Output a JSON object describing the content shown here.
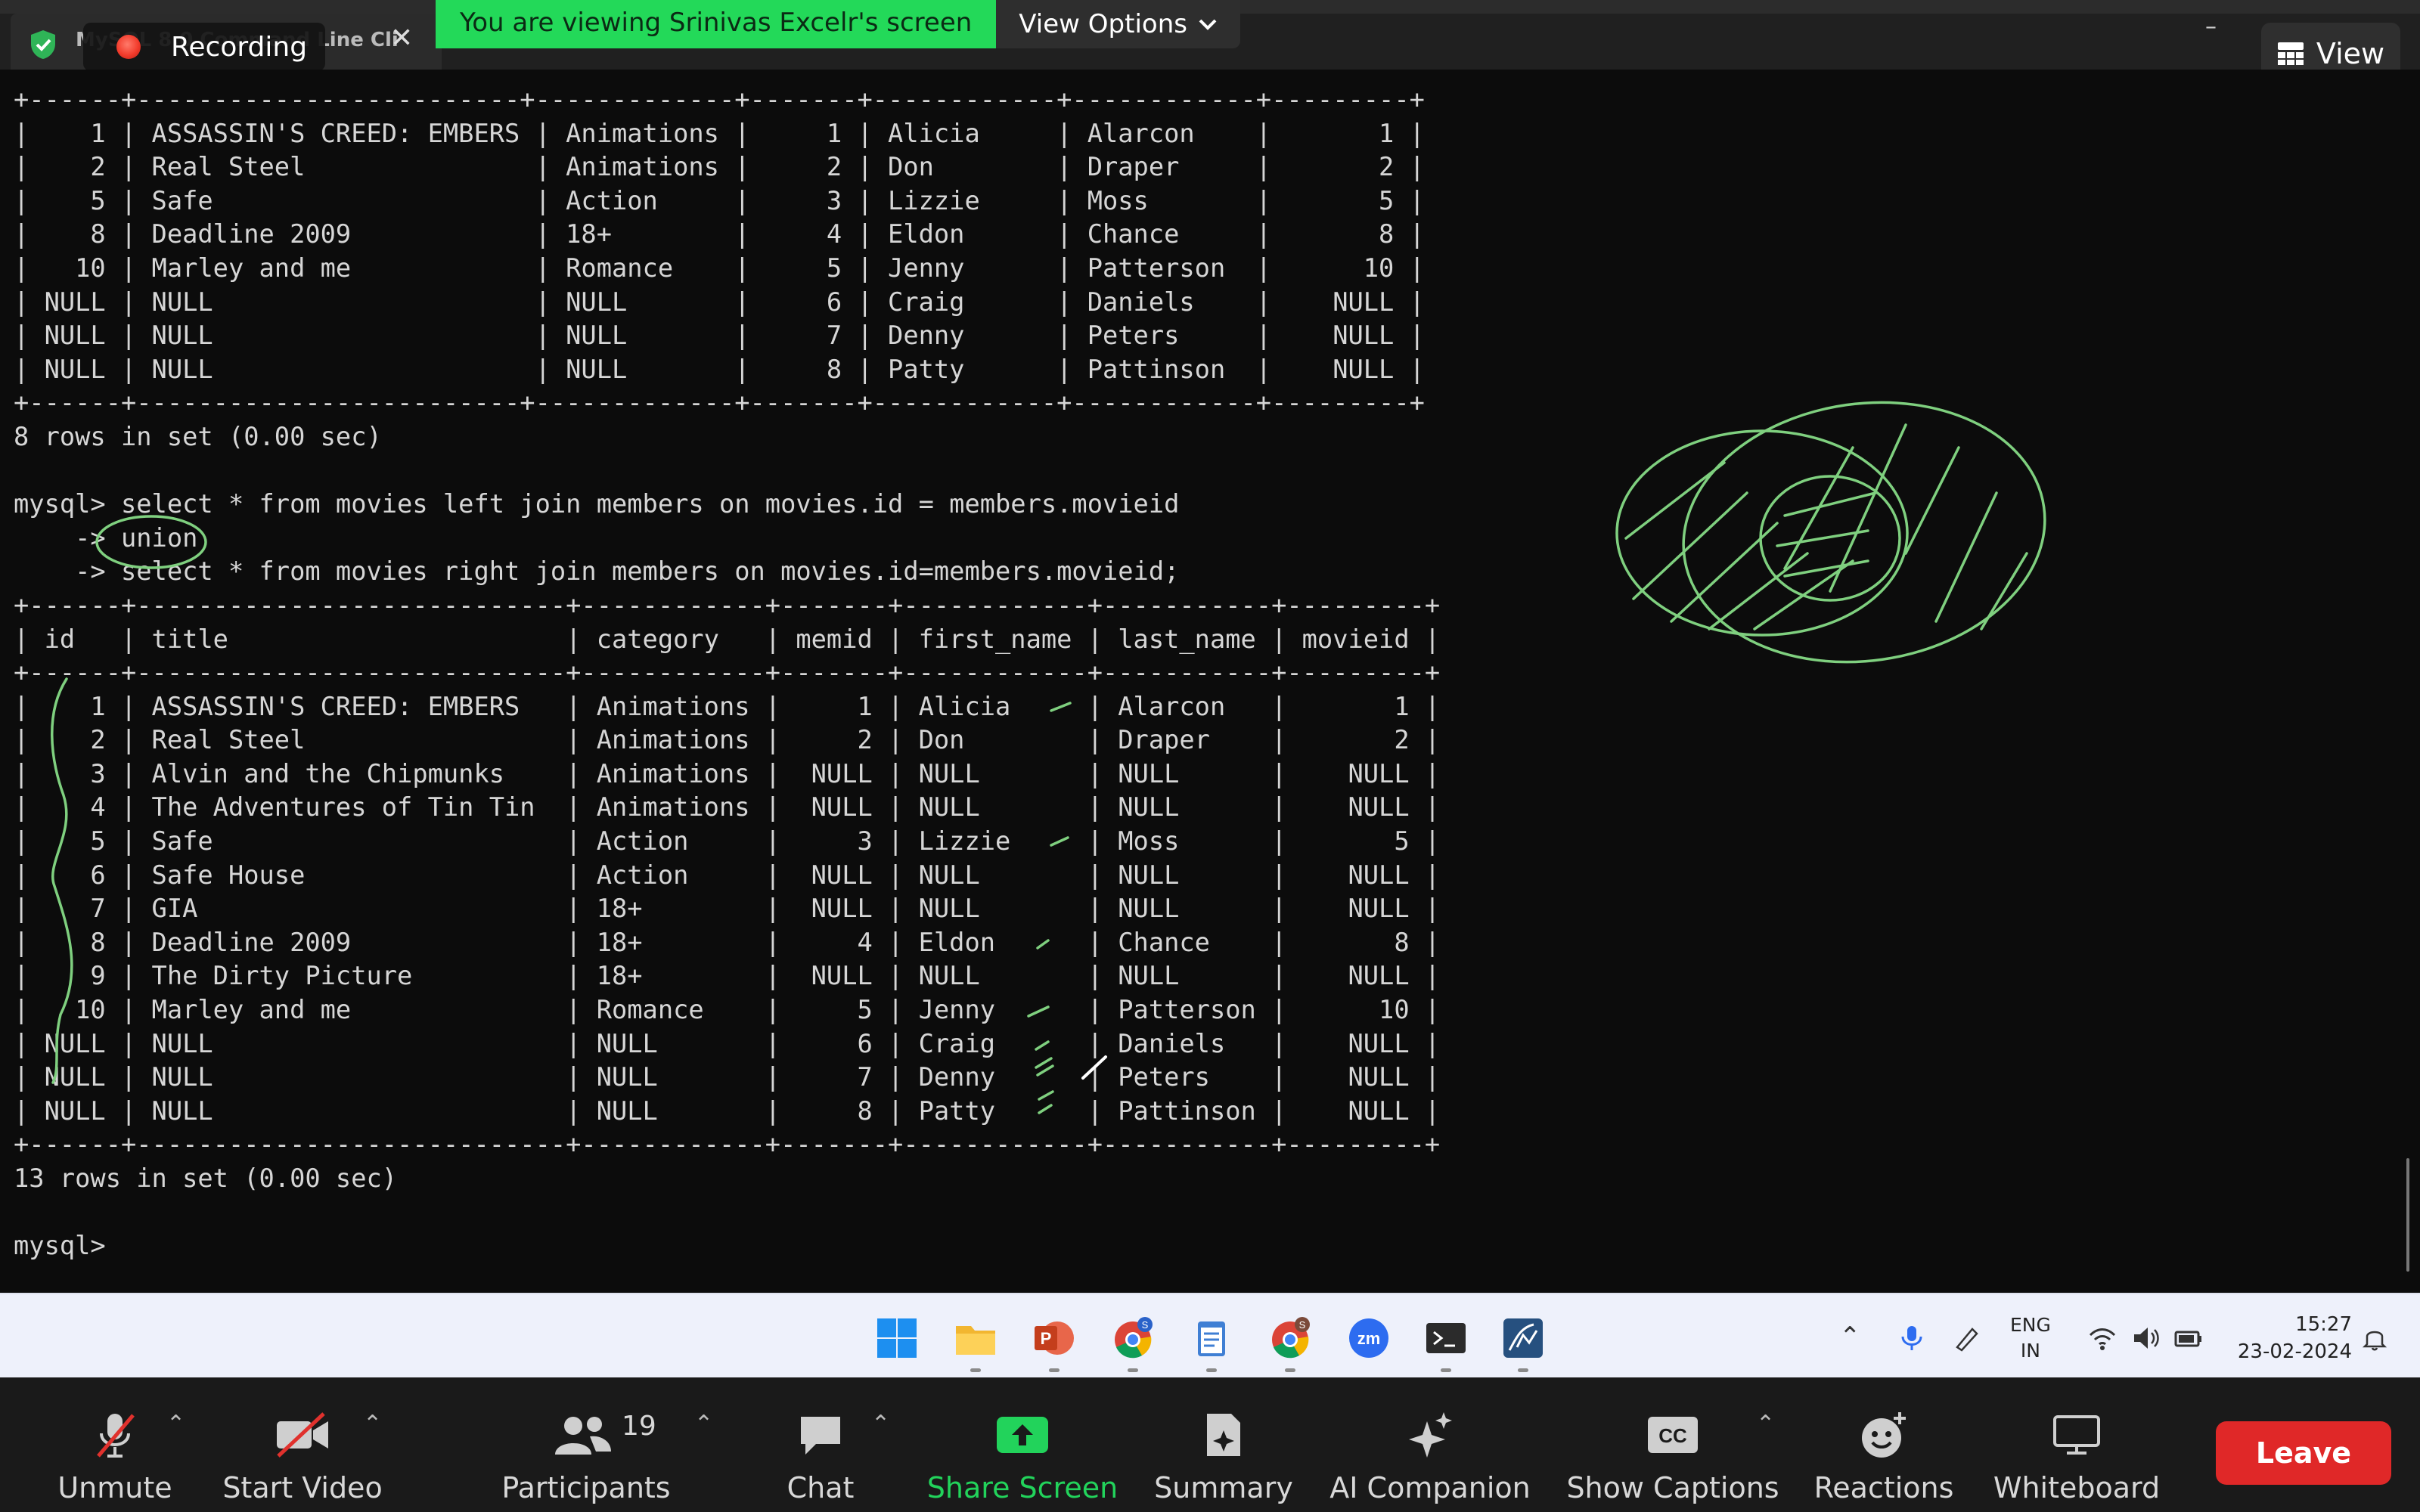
{
  "window": {
    "tab_title": "MySQL 8.0 Command Line Cli",
    "tab_close": "✕",
    "recording_label": "Recording",
    "minimize": "–"
  },
  "share_banner": {
    "text": "You are viewing Srinivas Excelr's screen",
    "view_options": "View Options"
  },
  "view_button": {
    "label": "View"
  },
  "terminal": {
    "lines": [
      "+------+-------------------------+-------------+-------+------------+------------+---------+",
      "|    1 | ASSASSIN'S CREED: EMBERS | Animations |     1 | Alicia     | Alarcon    |       1 |",
      "|    2 | Real Steel               | Animations |     2 | Don        | Draper     |       2 |",
      "|    5 | Safe                     | Action     |     3 | Lizzie     | Moss       |       5 |",
      "|    8 | Deadline 2009            | 18+        |     4 | Eldon      | Chance     |       8 |",
      "|   10 | Marley and me            | Romance    |     5 | Jenny      | Patterson  |      10 |",
      "| NULL | NULL                     | NULL       |     6 | Craig      | Daniels    |    NULL |",
      "| NULL | NULL                     | NULL       |     7 | Denny      | Peters     |    NULL |",
      "| NULL | NULL                     | NULL       |     8 | Patty      | Pattinson  |    NULL |",
      "+------+-------------------------+-------------+-------+------------+------------+---------+",
      "8 rows in set (0.00 sec)",
      "",
      "mysql> select * from movies left join members on movies.id = members.movieid",
      "    -> union",
      "    -> select * from movies right join members on movies.id=members.movieid;",
      "+------+----------------------------+------------+-------+------------+-----------+---------+",
      "| id   | title                      | category   | memid | first_name | last_name | movieid |",
      "+------+----------------------------+------------+-------+------------+-----------+---------+",
      "|    1 | ASSASSIN'S CREED: EMBERS   | Animations |     1 | Alicia     | Alarcon   |       1 |",
      "|    2 | Real Steel                 | Animations |     2 | Don        | Draper    |       2 |",
      "|    3 | Alvin and the Chipmunks    | Animations |  NULL | NULL       | NULL      |    NULL |",
      "|    4 | The Adventures of Tin Tin  | Animations |  NULL | NULL       | NULL      |    NULL |",
      "|    5 | Safe                       | Action     |     3 | Lizzie     | Moss      |       5 |",
      "|    6 | Safe House                 | Action     |  NULL | NULL       | NULL      |    NULL |",
      "|    7 | GIA                        | 18+        |  NULL | NULL       | NULL      |    NULL |",
      "|    8 | Deadline 2009              | 18+        |     4 | Eldon      | Chance    |       8 |",
      "|    9 | The Dirty Picture          | 18+        |  NULL | NULL       | NULL      |    NULL |",
      "|   10 | Marley and me              | Romance    |     5 | Jenny      | Patterson |      10 |",
      "| NULL | NULL                       | NULL       |     6 | Craig      | Daniels   |    NULL |",
      "| NULL | NULL                       | NULL       |     7 | Denny      | Peters    |    NULL |",
      "| NULL | NULL                       | NULL       |     8 | Patty      | Pattinson |    NULL |",
      "+------+----------------------------+------------+-------+------------+-----------+---------+",
      "13 rows in set (0.00 sec)",
      "",
      "mysql> "
    ]
  },
  "taskbar": {
    "apps": [
      "windows-start",
      "file-explorer",
      "powerpoint",
      "chrome-profile-s",
      "notepad",
      "chrome-profile-s2",
      "zoom",
      "terminal",
      "mysql-workbench"
    ],
    "lang_line1": "ENG",
    "lang_line2": "IN",
    "time": "15:27",
    "date": "23-02-2024"
  },
  "zoom_controls": {
    "unmute": "Unmute",
    "start_video": "Start Video",
    "participants": "Participants",
    "participants_count": "19",
    "chat": "Chat",
    "share_screen": "Share Screen",
    "summary": "Summary",
    "ai_companion": "AI Companion",
    "show_captions": "Show Captions",
    "captions_icon_text": "CC",
    "reactions": "Reactions",
    "whiteboard": "Whiteboard",
    "leave": "Leave",
    "share_color": "#22d35b",
    "leave_color": "#e02828"
  },
  "colors": {
    "annotation": "#7fd07f",
    "terminal_bg": "#0c0c0c",
    "terminal_fg": "#d6d6d6"
  }
}
